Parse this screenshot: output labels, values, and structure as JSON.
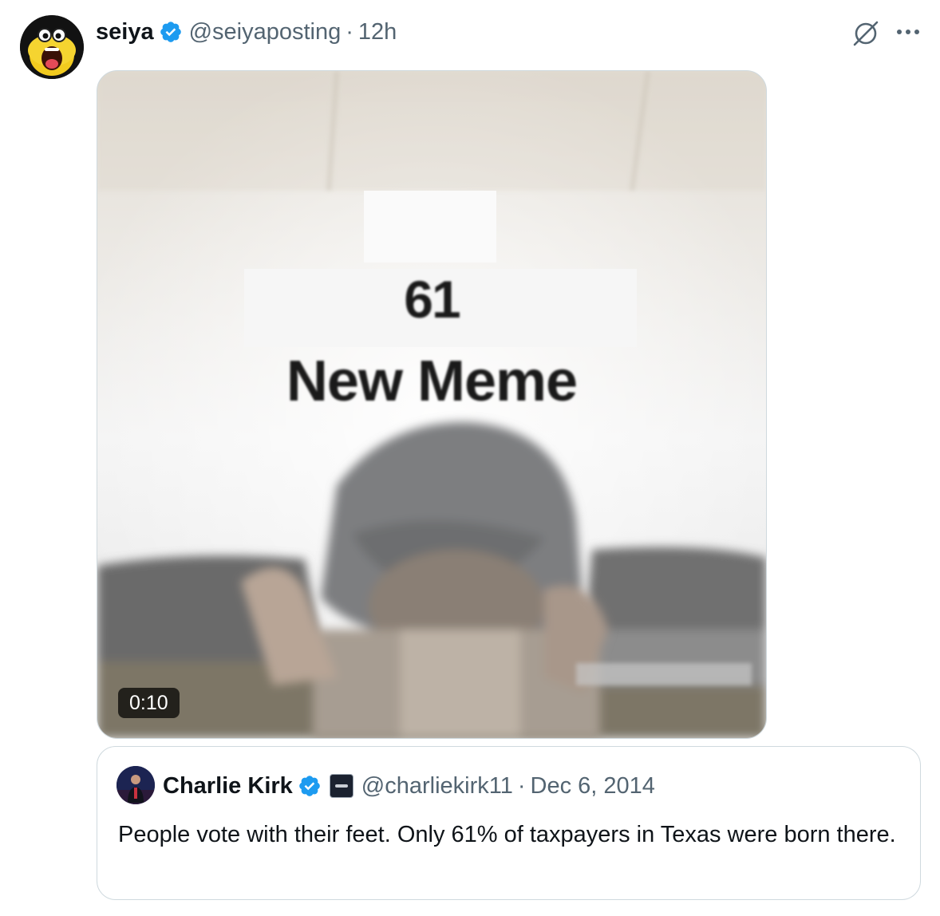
{
  "post": {
    "author": {
      "display_name": "seiya",
      "handle": "@seiyaposting",
      "verified": true
    },
    "separator": "·",
    "time": "12h",
    "icons": [
      "grok-icon",
      "more-icon"
    ],
    "media": {
      "type": "video",
      "overlay_number": "61",
      "overlay_title": "New Meme",
      "duration": "0:10"
    }
  },
  "quoted": {
    "author": {
      "display_name": "Charlie Kirk",
      "handle": "@charliekirk11",
      "verified": true
    },
    "separator": "·",
    "date": "Dec 6, 2014",
    "text": "People vote with their feet. Only 61% of taxpayers in Texas were born there."
  },
  "colors": {
    "text_primary": "#0f1419",
    "text_secondary": "#536471",
    "verified_blue": "#1d9bf0",
    "border": "#cfd9de"
  }
}
